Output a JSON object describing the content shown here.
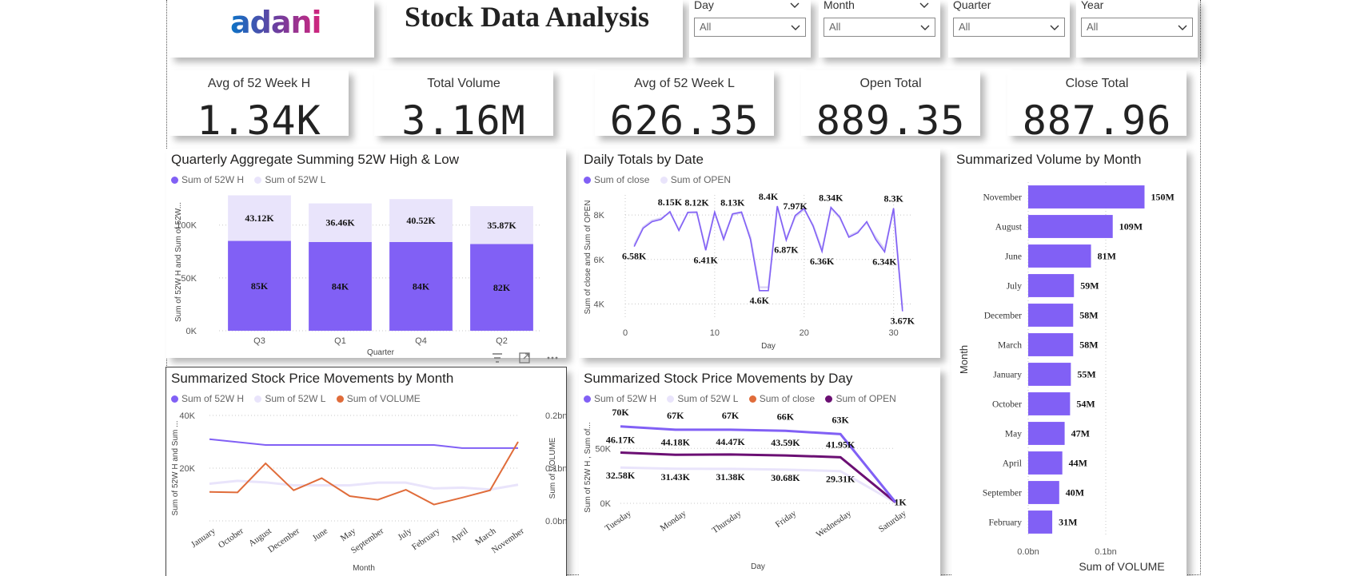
{
  "header": {
    "logo_text": "adani",
    "title": "Stock Data Analysis"
  },
  "slicers": [
    {
      "label": "Day",
      "value": "All"
    },
    {
      "label": "Month",
      "value": "All"
    },
    {
      "label": "Quarter",
      "value": "All"
    },
    {
      "label": "Year",
      "value": "All"
    }
  ],
  "kpis": [
    {
      "label": "Avg of 52 Week H",
      "value": "1.34K"
    },
    {
      "label": "Total Volume",
      "value": "3.16M"
    },
    {
      "label": "Avg of 52 Week L",
      "value": "626.35"
    },
    {
      "label": "Open Total",
      "value": "889.35"
    },
    {
      "label": "Close Total",
      "value": "887.96"
    }
  ],
  "colors": {
    "purple": "#8160f5",
    "lavender": "#e9e4fb",
    "orange": "#e06c3a",
    "dark_purple": "#6b0f73",
    "line_light": "#d9d2f7"
  },
  "chart_data": [
    {
      "id": "quarterly",
      "type": "bar",
      "stacked": true,
      "title": "Quarterly Aggregate Summing 52W High & Low",
      "xlabel": "Quarter",
      "ylabel": "Sum of 52W H and Sum of 52W...",
      "categories": [
        "Q3",
        "Q1",
        "Q4",
        "Q2"
      ],
      "series": [
        {
          "name": "Sum of 52W H",
          "values": [
            85000,
            84000,
            84000,
            82000
          ],
          "labels": [
            "85K",
            "84K",
            "84K",
            "82K"
          ]
        },
        {
          "name": "Sum of 52W L",
          "values": [
            43120,
            36460,
            40520,
            35870
          ],
          "labels": [
            "43.12K",
            "36.46K",
            "40.52K",
            "35.87K"
          ]
        }
      ],
      "ylim": [
        0,
        130000
      ],
      "yticks": [
        0,
        50000,
        100000
      ],
      "yticklabels": [
        "0K",
        "50K",
        "100K"
      ],
      "legend": "top-left",
      "grid": true
    },
    {
      "id": "daily",
      "type": "line",
      "title": "Daily Totals by Date",
      "xlabel": "Day",
      "ylabel": "Sum of close and Sum of OPEN",
      "xlim": [
        0,
        32
      ],
      "ylim": [
        3300,
        8900
      ],
      "xticks": [
        0,
        10,
        20,
        30
      ],
      "yticks": [
        4000,
        6000,
        8000
      ],
      "yticklabels": [
        "4K",
        "6K",
        "8K"
      ],
      "series": [
        {
          "name": "Sum of close",
          "x": [
            1,
            2,
            3,
            4,
            5,
            6,
            7,
            8,
            9,
            10,
            11,
            12,
            13,
            14,
            15,
            16,
            17,
            18,
            19,
            20,
            21,
            22,
            23,
            24,
            25,
            26,
            27,
            28,
            29,
            30,
            31
          ],
          "values": [
            6580,
            7400,
            7700,
            7800,
            8150,
            7300,
            8120,
            8130,
            6410,
            8130,
            6900,
            8050,
            8130,
            6900,
            4600,
            4600,
            8400,
            6870,
            7970,
            8300,
            7500,
            6360,
            8340,
            7900,
            7000,
            7200,
            7700,
            6900,
            6340,
            8300,
            3670
          ]
        },
        {
          "name": "Sum of OPEN",
          "x": [
            1,
            2,
            3,
            4,
            5,
            6,
            7,
            8,
            9,
            10,
            11,
            12,
            13,
            14,
            15,
            16,
            17,
            18,
            19,
            20,
            21,
            22,
            23,
            24,
            25,
            26,
            27,
            28,
            29,
            30,
            31
          ],
          "values": [
            6650,
            7450,
            7750,
            7850,
            8100,
            7350,
            8100,
            8100,
            6500,
            8100,
            7000,
            8000,
            8100,
            7000,
            4750,
            4750,
            8350,
            6950,
            7900,
            8250,
            7550,
            6450,
            8300,
            7850,
            7050,
            7250,
            7650,
            7000,
            6450,
            8250,
            3800
          ]
        }
      ],
      "annotations": [
        {
          "x": 1,
          "y": 6580,
          "label": "6.58K"
        },
        {
          "x": 5,
          "y": 8150,
          "label": "8.15K"
        },
        {
          "x": 8,
          "y": 8120,
          "label": "8.12K"
        },
        {
          "x": 9,
          "y": 6410,
          "label": "6.41K"
        },
        {
          "x": 12,
          "y": 8130,
          "label": "8.13K"
        },
        {
          "x": 15,
          "y": 4600,
          "label": "4.6K"
        },
        {
          "x": 16,
          "y": 8400,
          "label": "8.4K"
        },
        {
          "x": 18,
          "y": 6870,
          "label": "6.87K"
        },
        {
          "x": 19,
          "y": 7970,
          "label": "7.97K"
        },
        {
          "x": 22,
          "y": 6360,
          "label": "6.36K"
        },
        {
          "x": 23,
          "y": 8340,
          "label": "8.34K"
        },
        {
          "x": 29,
          "y": 6340,
          "label": "6.34K"
        },
        {
          "x": 30,
          "y": 8300,
          "label": "8.3K"
        },
        {
          "x": 31,
          "y": 3670,
          "label": "3.67K"
        }
      ],
      "legend": "top-left",
      "grid": true
    },
    {
      "id": "volume_month",
      "type": "bar",
      "orientation": "horizontal",
      "title": "Summarized Volume by Month",
      "xlabel": "Sum of VOLUME",
      "ylabel": "Month",
      "categories": [
        "November",
        "August",
        "June",
        "July",
        "December",
        "March",
        "January",
        "October",
        "May",
        "April",
        "September",
        "February"
      ],
      "values": [
        150000000,
        109000000,
        81000000,
        59000000,
        58000000,
        58000000,
        55000000,
        54000000,
        47000000,
        44000000,
        40000000,
        31000000
      ],
      "labels": [
        "150M",
        "109M",
        "81M",
        "59M",
        "58M",
        "58M",
        "55M",
        "54M",
        "47M",
        "44M",
        "40M",
        "31M"
      ],
      "xlim": [
        0,
        200000000
      ],
      "xticks": [
        0,
        100000000
      ],
      "xticklabels": [
        "0.0bn",
        "0.1bn"
      ],
      "grid": true
    },
    {
      "id": "price_month",
      "type": "line",
      "title": "Summarized Stock Price Movements by Month",
      "xlabel": "Month",
      "ylabel": "Sum of 52W H and Sum ...",
      "y2label": "Sum of VOLUME",
      "categories": [
        "January",
        "October",
        "August",
        "December",
        "June",
        "May",
        "September",
        "July",
        "February",
        "April",
        "March",
        "November"
      ],
      "ylim": [
        0,
        40000
      ],
      "yticks": [
        20000,
        40000
      ],
      "yticklabels": [
        "20K",
        "40K"
      ],
      "y2lim": [
        0,
        0.2
      ],
      "y2ticks": [
        0,
        0.1,
        0.2
      ],
      "y2ticklabels": [
        "0.0bn",
        "0.1bn",
        "0.2bn"
      ],
      "series": [
        {
          "name": "Sum of 52W H",
          "axis": "left",
          "values": [
            31000,
            29900,
            28800,
            28800,
            28800,
            28800,
            28800,
            28800,
            28800,
            27600,
            27600,
            27600
          ]
        },
        {
          "name": "Sum of 52W L",
          "axis": "left",
          "values": [
            14100,
            15200,
            14600,
            13500,
            13500,
            13500,
            14500,
            14500,
            12300,
            12600,
            11900,
            13700
          ]
        },
        {
          "name": "Sum of VOLUME",
          "axis": "right",
          "values": [
            0.055,
            0.054,
            0.109,
            0.058,
            0.081,
            0.047,
            0.04,
            0.059,
            0.031,
            0.044,
            0.058,
            0.15
          ]
        }
      ],
      "legend": "top-left",
      "grid": true
    },
    {
      "id": "price_day",
      "type": "line",
      "title": "Summarized Stock Price Movements by Day",
      "xlabel": "Day",
      "ylabel": "Sum of 52W H , Sum of...",
      "categories": [
        "Tuesday",
        "Monday",
        "Thursday",
        "Friday",
        "Wednesday",
        "Saturday"
      ],
      "ylim": [
        0,
        80000
      ],
      "yticks": [
        0,
        50000
      ],
      "yticklabels": [
        "0K",
        "50K"
      ],
      "series": [
        {
          "name": "Sum of 52W H",
          "values": [
            70000,
            67000,
            67000,
            66000,
            63000,
            1000
          ],
          "labels": [
            "70K",
            "67K",
            "67K",
            "66K",
            "63K",
            "1K"
          ]
        },
        {
          "name": "Sum of 52W L",
          "values": [
            32580,
            31430,
            31380,
            30680,
            29310,
            600
          ],
          "labels": [
            "32.58K",
            "31.43K",
            "31.38K",
            "30.68K",
            "29.31K",
            ""
          ]
        },
        {
          "name": "Sum of close",
          "values": [
            46170,
            44180,
            44470,
            43590,
            41950,
            900
          ],
          "labels": [
            "",
            "",
            "",
            "",
            "",
            ""
          ]
        },
        {
          "name": "Sum of OPEN",
          "values": [
            46170,
            44180,
            44470,
            43590,
            41950,
            900
          ],
          "labels": [
            "46.17K",
            "44.18K",
            "44.47K",
            "43.59K",
            "41.95K",
            ""
          ]
        }
      ],
      "legend": "top-left",
      "grid": true
    }
  ]
}
